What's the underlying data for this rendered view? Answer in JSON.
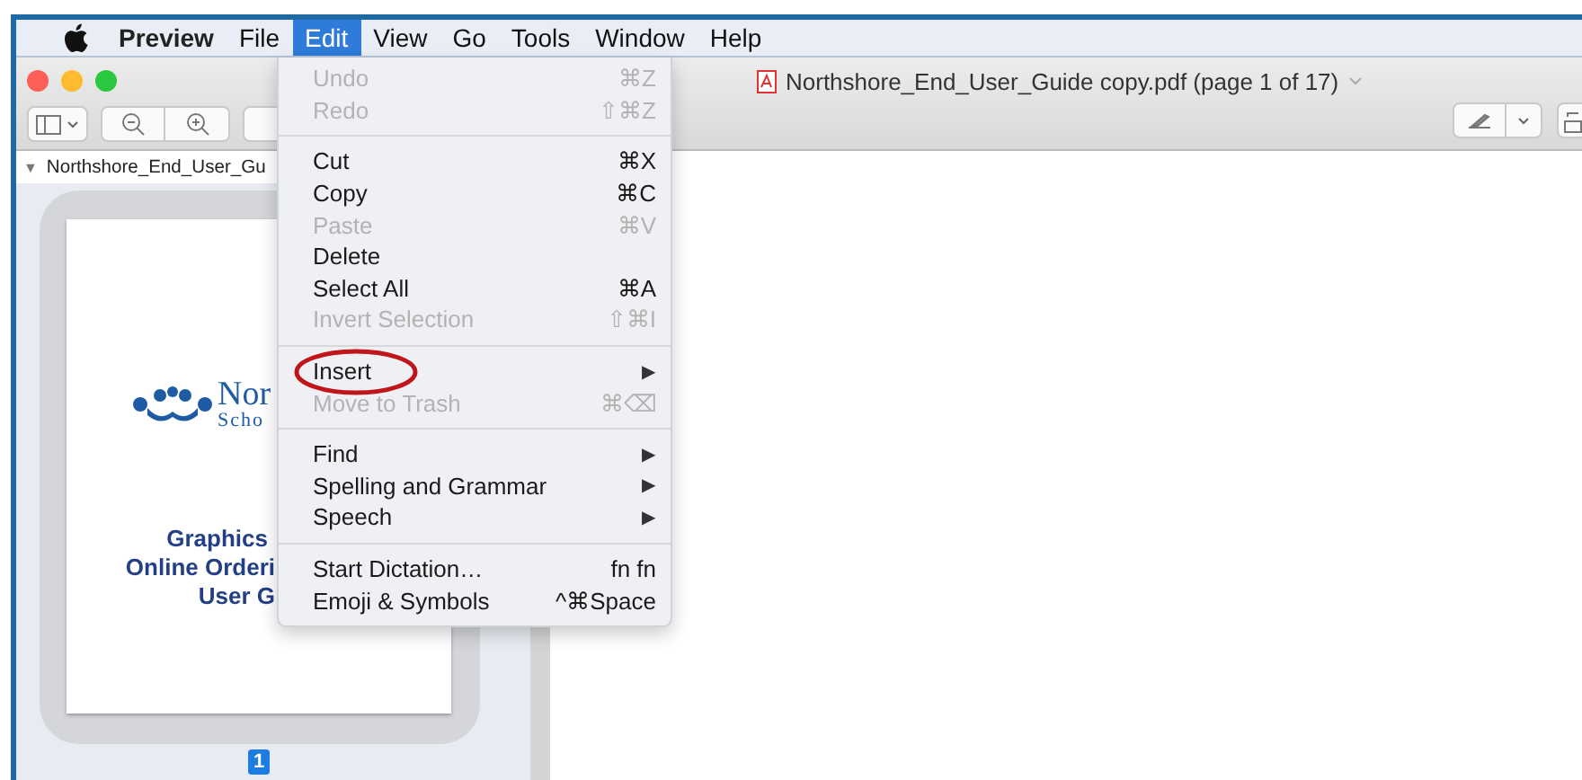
{
  "menubar": {
    "app_name": "Preview",
    "menus": [
      {
        "label": "File",
        "selected": false
      },
      {
        "label": "Edit",
        "selected": true
      },
      {
        "label": "View",
        "selected": false
      },
      {
        "label": "Go",
        "selected": false
      },
      {
        "label": "Tools",
        "selected": false
      },
      {
        "label": "Window",
        "selected": false
      },
      {
        "label": "Help",
        "selected": false
      }
    ]
  },
  "window": {
    "title": "Northshore_End_User_Guide copy.pdf (page 1 of 17)"
  },
  "sidebar": {
    "disclosure": "▼",
    "document": "Northshore_End_User_Gu",
    "thumbnail": {
      "logo_line_1": "Nor",
      "logo_line_2": "Scho",
      "title_lines": [
        "Graphics",
        "Online Orderi",
        "User G"
      ]
    },
    "page_number": "1"
  },
  "edit_menu": {
    "items": [
      {
        "kind": "item",
        "label": "Undo",
        "shortcut": "⌘Z",
        "disabled": true,
        "circled": false
      },
      {
        "kind": "item",
        "label": "Redo",
        "shortcut": "⇧⌘Z",
        "disabled": true,
        "circled": false
      },
      {
        "kind": "separator"
      },
      {
        "kind": "item",
        "label": "Cut",
        "shortcut": "⌘X",
        "disabled": false,
        "circled": false
      },
      {
        "kind": "item",
        "label": "Copy",
        "shortcut": "⌘C",
        "disabled": false,
        "circled": false
      },
      {
        "kind": "item",
        "label": "Paste",
        "shortcut": "⌘V",
        "disabled": true,
        "circled": false
      },
      {
        "kind": "item",
        "label": "Delete",
        "disabled": false,
        "circled": false
      },
      {
        "kind": "item",
        "label": "Select All",
        "shortcut": "⌘A",
        "disabled": false,
        "circled": false
      },
      {
        "kind": "item",
        "label": "Invert Selection",
        "shortcut": "⇧⌘I",
        "disabled": true,
        "circled": false
      },
      {
        "kind": "separator"
      },
      {
        "kind": "item",
        "label": "Insert",
        "submenu": "▶",
        "disabled": false,
        "circled": true
      },
      {
        "kind": "item",
        "label": "Move to Trash",
        "shortcut": "⌘⌫",
        "disabled": true,
        "circled": false
      },
      {
        "kind": "separator"
      },
      {
        "kind": "item",
        "label": "Find",
        "submenu": "▶",
        "disabled": false,
        "circled": false
      },
      {
        "kind": "item",
        "label": "Spelling and Grammar",
        "submenu": "▶",
        "disabled": false,
        "circled": false
      },
      {
        "kind": "item",
        "label": "Speech",
        "submenu": "▶",
        "disabled": false,
        "circled": false
      },
      {
        "kind": "separator"
      },
      {
        "kind": "item",
        "label": "Start Dictation…",
        "shortcut": "fn fn",
        "disabled": false,
        "circled": false
      },
      {
        "kind": "item",
        "label": "Emoji & Symbols",
        "shortcut": "^⌘Space",
        "disabled": false,
        "circled": false
      }
    ]
  }
}
